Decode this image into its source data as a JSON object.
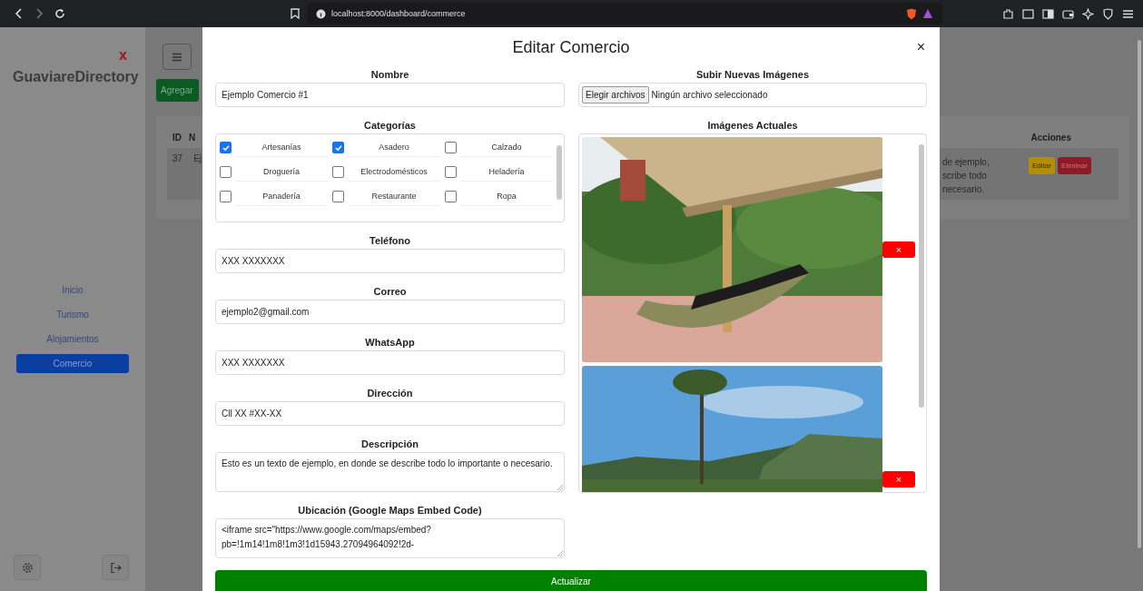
{
  "browser": {
    "url": "localhost:8000/dashboard/commerce"
  },
  "sidebar": {
    "close": "x",
    "brand": "GuaviareDirectory",
    "items": [
      {
        "label": "Inicio",
        "selected": false
      },
      {
        "label": "Turismo",
        "selected": false
      },
      {
        "label": "Alojamientos",
        "selected": false
      },
      {
        "label": "Comercio",
        "selected": true
      }
    ]
  },
  "main": {
    "add_button": "Agregar",
    "table": {
      "columns": [
        "ID",
        "N"
      ],
      "row": [
        "37",
        "Ej"
      ],
      "right_column": "Acciones",
      "description_fragment": "de ejemplo,\nscribe todo\nnecesario.",
      "actions": [
        "Editar",
        "Eliminar"
      ]
    }
  },
  "modal": {
    "title": "Editar Comercio",
    "close": "×",
    "fields": [
      {
        "kind": "input",
        "label": "Nombre",
        "value": "Ejemplo Comercio #1"
      },
      {
        "kind": "categories",
        "label": "Categorías",
        "options": [
          {
            "label": "Artesanías",
            "checked": true
          },
          {
            "label": "Asadero",
            "checked": true
          },
          {
            "label": "Calzado",
            "checked": false
          },
          {
            "label": "Droguería",
            "checked": false
          },
          {
            "label": "Electrodomésticos",
            "checked": false
          },
          {
            "label": "Heladería",
            "checked": false
          },
          {
            "label": "Panadería",
            "checked": false
          },
          {
            "label": "Restaurante",
            "checked": false
          },
          {
            "label": "Ropa",
            "checked": false
          }
        ]
      },
      {
        "kind": "input",
        "label": "Teléfono",
        "value": "XXX XXXXXXX"
      },
      {
        "kind": "input",
        "label": "Correo",
        "value": "ejemplo2@gmail.com"
      },
      {
        "kind": "input",
        "label": "WhatsApp",
        "value": "XXX XXXXXXX"
      },
      {
        "kind": "input",
        "label": "Dirección",
        "value": "Cll XX #XX-XX"
      },
      {
        "kind": "textarea",
        "label": "Descripción",
        "value": "Esto es un texto de ejemplo, en donde se describe todo lo importante o necesario."
      },
      {
        "kind": "textarea",
        "label": "Ubicación (Google Maps Embed Code)",
        "value": "<iframe src=\"https://www.google.com/maps/embed?\npb=!1m14!1m8!1m3!1d15943.27094964092!2d-"
      }
    ],
    "upload": {
      "label": "Subir Nuevas Imágenes",
      "button": "Elegir archivos",
      "status": "Ningún archivo seleccionado"
    },
    "images": {
      "label": "Imágenes Actuales",
      "items": [
        {
          "kind": "porch",
          "remove": "×"
        },
        {
          "kind": "landscape",
          "remove": "×"
        }
      ]
    },
    "submit": "Actualizar"
  }
}
